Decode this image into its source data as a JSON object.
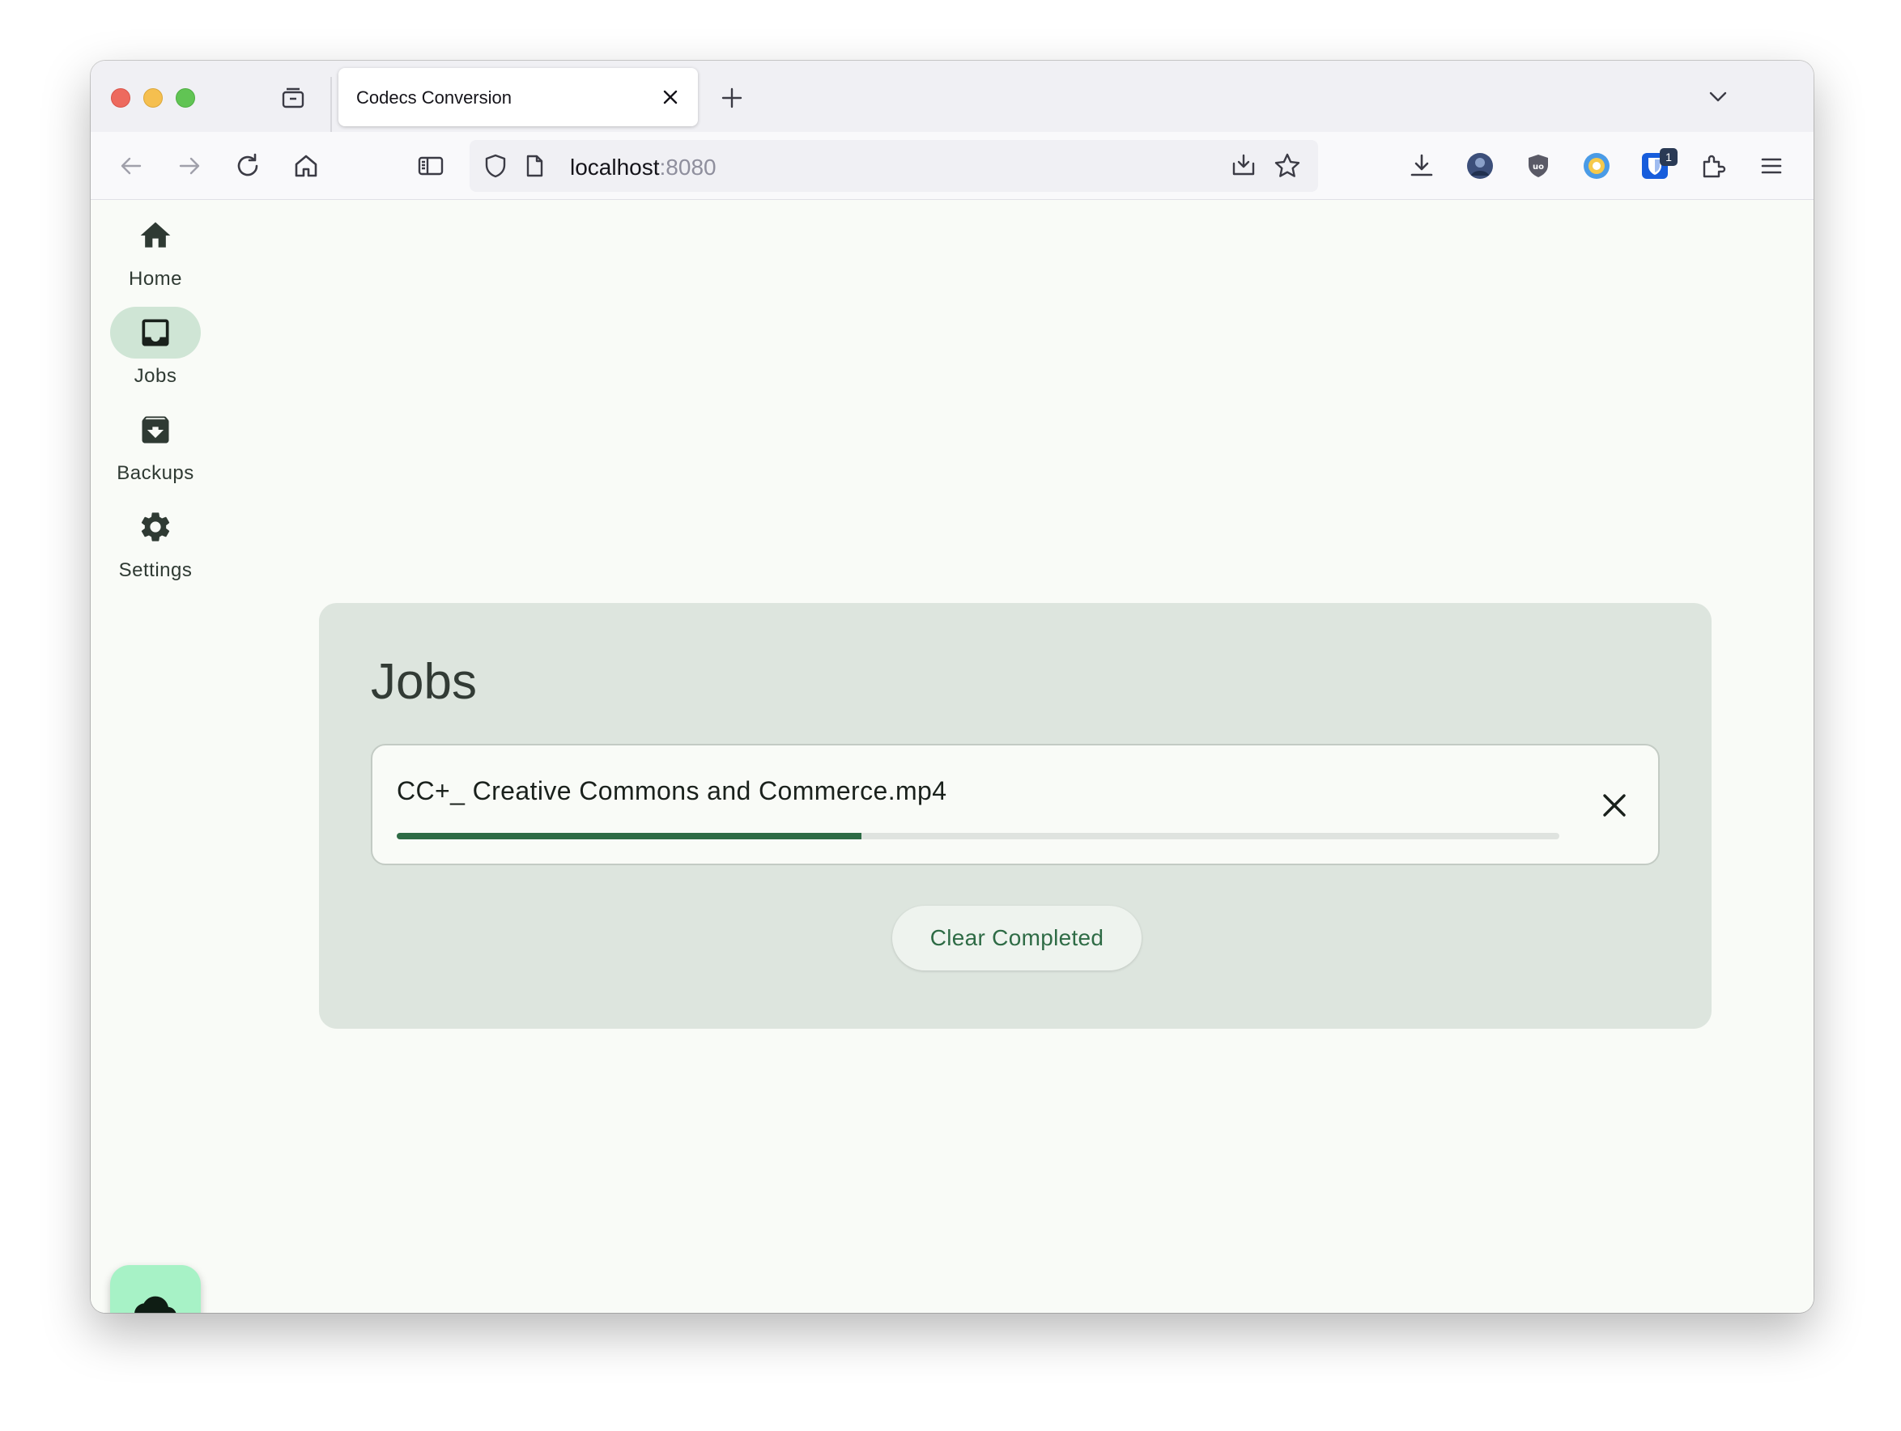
{
  "browser": {
    "tab_title": "Codecs Conversion",
    "url_host": "localhost",
    "url_port": ":8080",
    "extension_badge": "1"
  },
  "rail": {
    "items": [
      {
        "label": "Home",
        "icon": "home-icon",
        "active": false
      },
      {
        "label": "Jobs",
        "icon": "inbox-icon",
        "active": true
      },
      {
        "label": "Backups",
        "icon": "archive-icon",
        "active": false
      },
      {
        "label": "Settings",
        "icon": "gear-icon",
        "active": false
      }
    ],
    "fab_icon": "cloud-icon"
  },
  "jobs": {
    "title": "Jobs",
    "list": [
      {
        "name": "CC+_ Creative Commons and Commerce.mp4",
        "progress": 0.4
      }
    ],
    "clear_label": "Clear Completed"
  },
  "colors": {
    "accent": "#2e6b45",
    "active_pill": "#cfe5d5",
    "fab": "#a7f2c6",
    "card": "#dde5de"
  }
}
